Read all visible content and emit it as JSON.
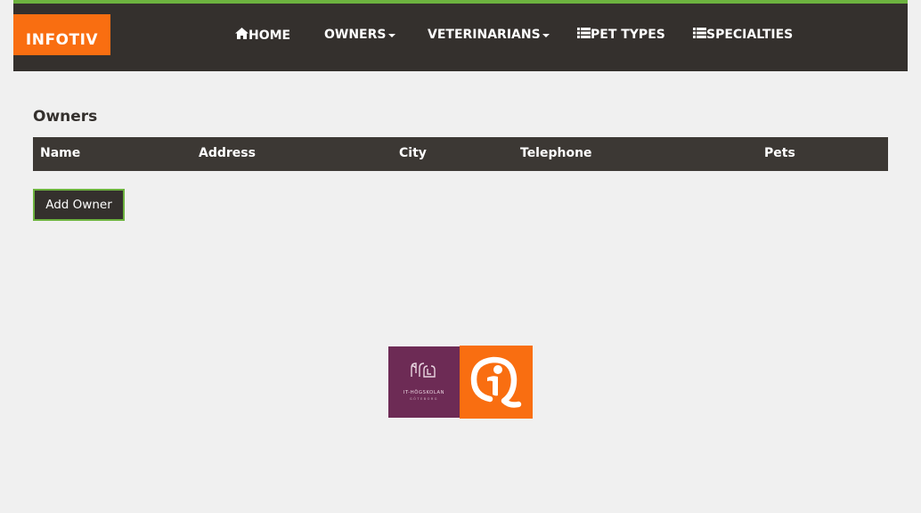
{
  "navbar": {
    "brand": "INFOTIV",
    "items": [
      {
        "label": "HOME",
        "icon": "home-icon"
      },
      {
        "label": "OWNERS",
        "icon": "caret-down-icon"
      },
      {
        "label": "VETERINARIANS",
        "icon": "caret-down-icon"
      },
      {
        "label": "PET TYPES",
        "icon": "list-icon"
      },
      {
        "label": "SPECIALTIES",
        "icon": "list-icon"
      }
    ]
  },
  "main": {
    "title": "Owners",
    "table": {
      "columns": [
        "Name",
        "Address",
        "City",
        "Telephone",
        "Pets"
      ],
      "rows": []
    },
    "add_button": "Add Owner"
  },
  "footer": {
    "logo_itg_line1": "IT-HÖGSKOLAN",
    "logo_itg_line2": "GÖTEBORG"
  },
  "colors": {
    "accent_green": "#6db33f",
    "brand_orange": "#f96e11",
    "navbar_bg": "#34302d",
    "itg_purple": "#6d2b55"
  }
}
